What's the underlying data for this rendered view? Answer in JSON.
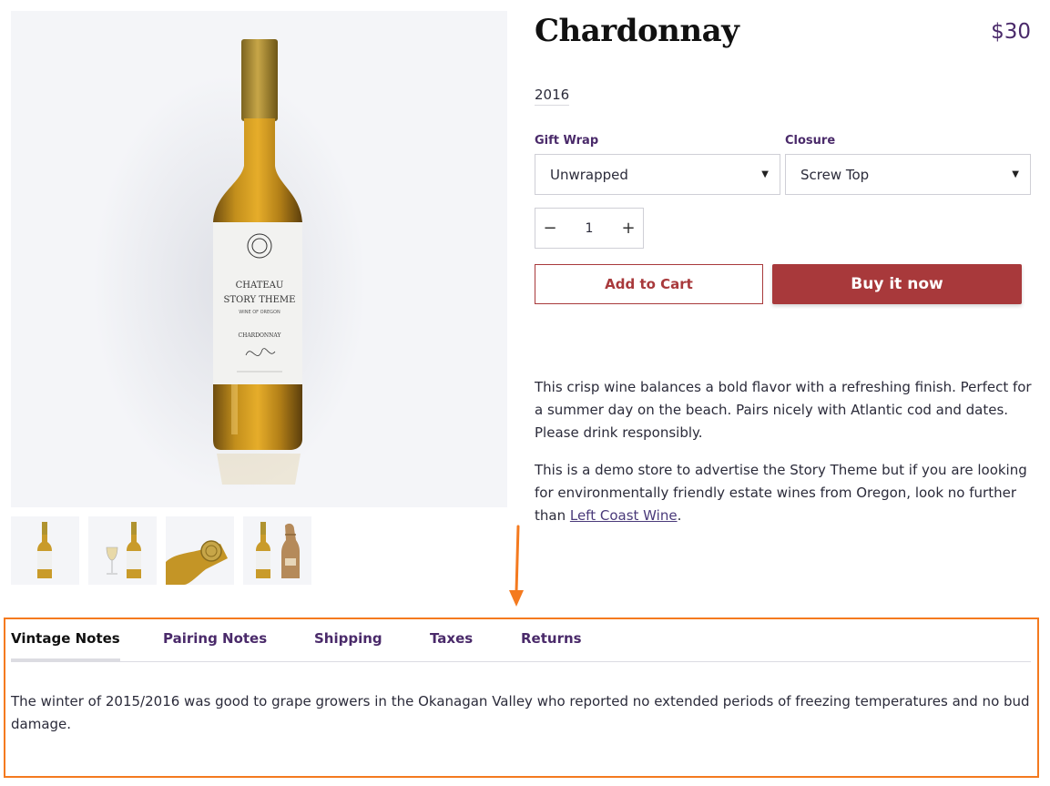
{
  "product": {
    "title": "Chardonnay",
    "price": "$30",
    "vintage": "2016",
    "bottle_label": {
      "line1": "CHATEAU",
      "line2": "STORY THEME",
      "line3": "WINE OF OREGON",
      "varietal": "CHARDONNAY"
    }
  },
  "gallery": {
    "thumbnails": [
      "bottle-front",
      "bottle-with-glass",
      "bottle-top",
      "bottle-with-wrap"
    ]
  },
  "options": {
    "gift_wrap": {
      "label": "Gift Wrap",
      "value": "Unwrapped"
    },
    "closure": {
      "label": "Closure",
      "value": "Screw Top"
    }
  },
  "quantity": {
    "minus": "−",
    "value": "1",
    "plus": "+"
  },
  "actions": {
    "add_to_cart": "Add to Cart",
    "buy_now": "Buy it now"
  },
  "description": {
    "p1": "This crisp wine balances a bold flavor with a refreshing finish. Perfect for a summer day on the beach. Pairs nicely with Atlantic cod and dates.  Please drink responsibly.",
    "p2_before": "This is a demo store to advertise the Story Theme but if you are looking for environmentally friendly estate wines from Oregon, look no further than ",
    "p2_link": "Left Coast Wine",
    "p2_after": "."
  },
  "tabs": {
    "items": [
      "Vintage Notes",
      "Pairing Notes",
      "Shipping",
      "Taxes",
      "Returns"
    ],
    "active": "Vintage Notes",
    "content": "The winter of 2015/2016 was good to grape growers in the Okanagan Valley who reported no extended periods of freezing temperatures and no bud damage."
  },
  "colors": {
    "accent_purple": "#4a2a6a",
    "button_red": "#a8393b",
    "annotation_orange": "#f47a1f"
  }
}
